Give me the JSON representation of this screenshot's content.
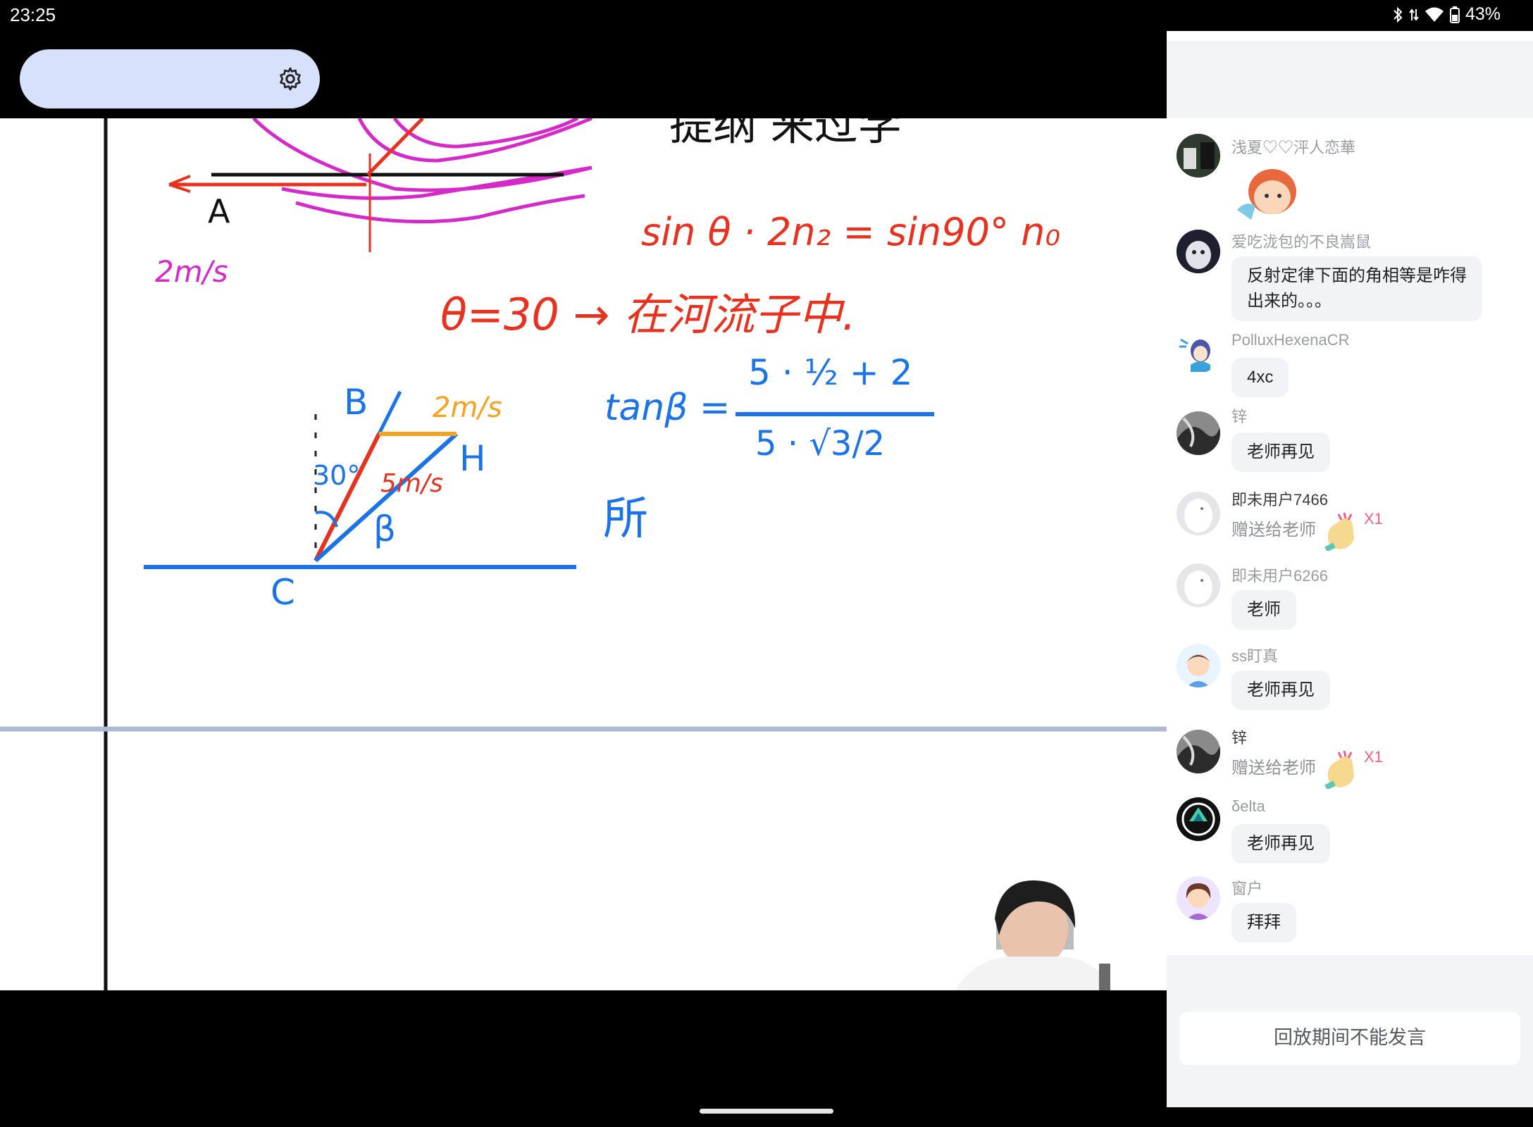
{
  "status_bar": {
    "time": "23:25",
    "battery": "43%",
    "icons": [
      "bluetooth-icon",
      "data-arrows-icon",
      "wifi-icon",
      "battery-icon"
    ]
  },
  "top_bar": {
    "settings_icon": "gear-icon"
  },
  "whiteboard": {
    "texts": {
      "pointA": "A",
      "speed_pink": "2m/s",
      "eq1": "sin θ · 2n₂ = sin90° n₀",
      "eq2": "θ=30 → 在河流子中.",
      "pointB": "B",
      "speed_orange": "2m/s",
      "pointH": "H",
      "angle": "30°",
      "speed_red": "5m/s",
      "beta": "β",
      "pointC": "C",
      "tan_lhs": "tanβ =",
      "tan_num": "5 · ½ + 2",
      "tan_den": "5 · √3/2",
      "scribble": "所",
      "heading": "提纲 来过学"
    }
  },
  "chat": {
    "messages": [
      {
        "user": "浅夏♡♡泙人恋華",
        "type": "sticker",
        "avatar": "avatar-photo"
      },
      {
        "user": "爱吃泷包的不良嵩鼠",
        "type": "text",
        "text_line1": "反射定律下面的角相等是咋得",
        "text_line2": "出来的。。。"
      },
      {
        "user": "PolluxHexenaCR",
        "type": "text",
        "text": "4xc"
      },
      {
        "user": "锌",
        "type": "text",
        "text": "老师再见"
      },
      {
        "user": "即未用户7466",
        "type": "gift",
        "text": "赠送给老师",
        "count": "X1"
      },
      {
        "user": "即未用户6266",
        "type": "text",
        "text": "老师"
      },
      {
        "user": "ss盯真",
        "type": "text",
        "text": "老师再见"
      },
      {
        "user": "锌",
        "type": "gift",
        "text": "赠送给老师",
        "count": "X1"
      },
      {
        "user": "δelta",
        "type": "text",
        "text": "老师再见"
      },
      {
        "user": "窗户",
        "type": "text",
        "text": "拜拜"
      }
    ],
    "input_placeholder": "回放期间不能发言"
  },
  "colors": {
    "accent_pill": "#d8e1fb",
    "ink_blue": "#1a73e8",
    "ink_red": "#e8321f",
    "ink_pink": "#d629c9",
    "ink_orange": "#f5a21c",
    "gift_count": "#ee5d86"
  }
}
